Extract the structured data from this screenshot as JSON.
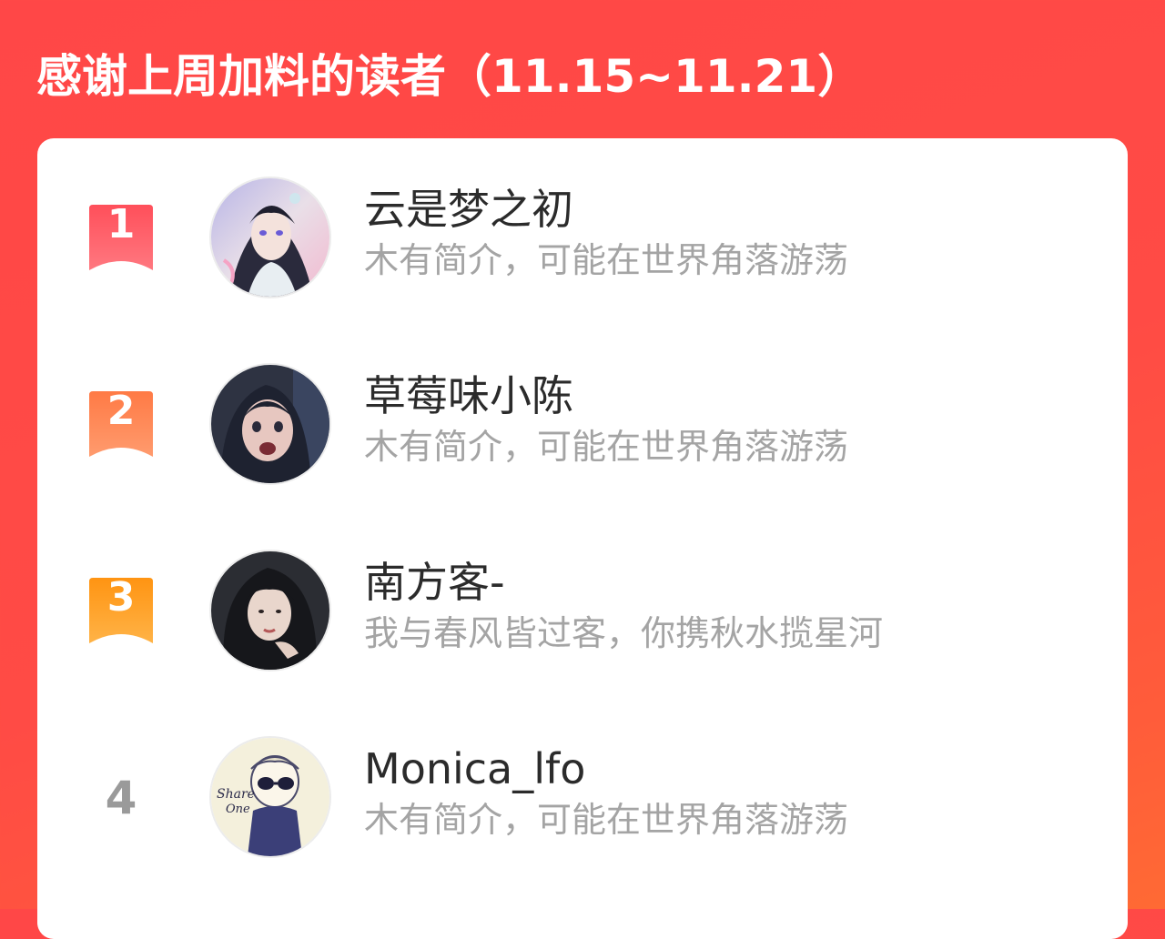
{
  "header": {
    "title": "感谢上周加料的读者（11.15~11.21）"
  },
  "colors": {
    "background": "#ff4747",
    "card": "#ffffff",
    "rank1": "#ff5a5f",
    "rank2": "#ff7f4e",
    "rank3": "#ff9a1f",
    "rank_plain": "#9a9a9a",
    "name": "#2b2b2b",
    "bio": "#a4a4a4"
  },
  "readers": [
    {
      "rank": "1",
      "name": "云是梦之初",
      "bio": "木有简介，可能在世界角落游荡",
      "avatar_icon": "anime-character-avatar"
    },
    {
      "rank": "2",
      "name": "草莓味小陈",
      "bio": "木有简介，可能在世界角落游荡",
      "avatar_icon": "anime-girl-avatar"
    },
    {
      "rank": "3",
      "name": "南方客-",
      "bio": "我与春风皆过客，你携秋水揽星河",
      "avatar_icon": "portrait-photo-avatar"
    },
    {
      "rank": "4",
      "name": "Monica_lfo",
      "bio": "木有简介，可能在世界角落游荡",
      "avatar_icon": "cartoon-sunglasses-avatar"
    }
  ]
}
